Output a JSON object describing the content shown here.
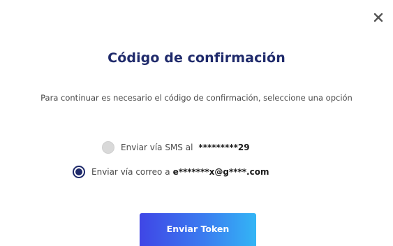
{
  "dialog": {
    "title": "Código de confirmación",
    "subtitle": "Para continuar es necesario el código de confirmación, seleccione una opción",
    "close_icon": "close-icon"
  },
  "options": {
    "sms": {
      "label": "Enviar vía SMS al",
      "masked_value": "*********29",
      "selected": false
    },
    "email": {
      "label": "Enviar vía correo a",
      "masked_value": "e*******x@g****.com",
      "selected": true
    }
  },
  "submit": {
    "label": "Enviar Token"
  },
  "colors": {
    "title": "#1f2a6b",
    "radio_selected": "#1f2a6b",
    "button_gradient_start": "#3f46e6",
    "button_gradient_end": "#33b5f5"
  }
}
